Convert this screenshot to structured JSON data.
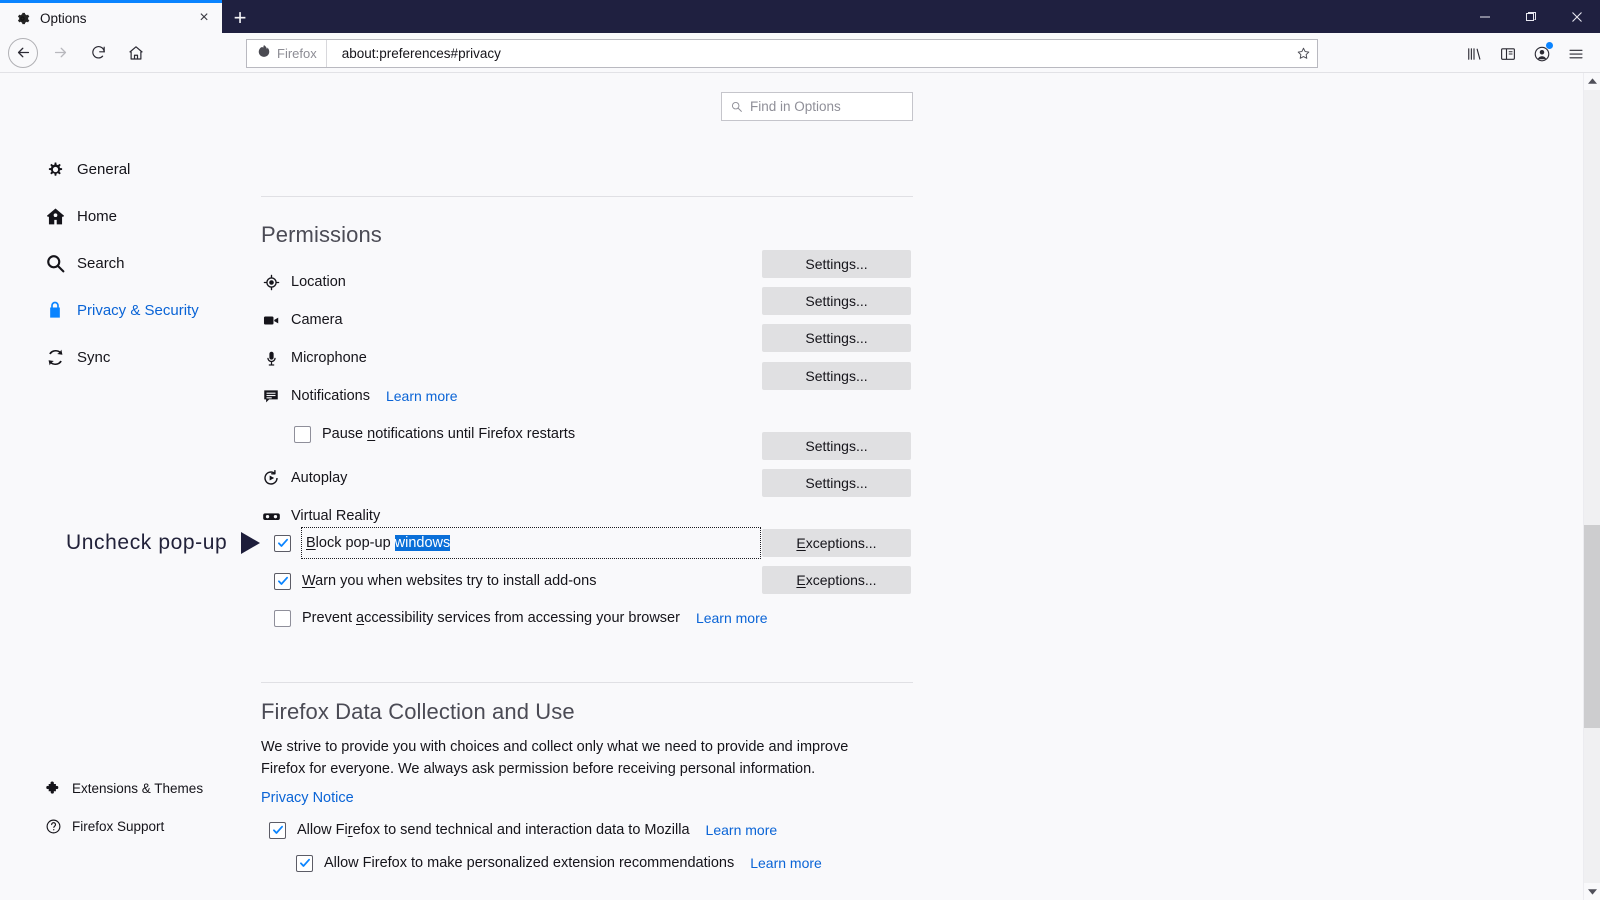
{
  "window": {
    "minimize_label": "—",
    "maximize_label": "❐",
    "close_label": "×"
  },
  "tab": {
    "title": "Options",
    "favicon": "gear-icon",
    "close_label": "×",
    "newtab_label": "+"
  },
  "toolbar": {
    "back_label": "←",
    "forward_label": "→",
    "reload_label": "↻",
    "home_label": "⌂",
    "url_chip_label": "Firefox",
    "url": "about:preferences#privacy",
    "star_label": "☆",
    "library_label": "library-icon",
    "sidebar_label": "sidebar-icon",
    "account_label": "account-icon",
    "menu_label": "≡"
  },
  "search": {
    "placeholder": "Find in Options",
    "value": ""
  },
  "sidebar": {
    "items": [
      {
        "label": "General",
        "icon": "gear-icon",
        "active": false
      },
      {
        "label": "Home",
        "icon": "home-icon",
        "active": false
      },
      {
        "label": "Search",
        "icon": "search-icon",
        "active": false
      },
      {
        "label": "Privacy & Security",
        "icon": "lock-icon",
        "active": true
      },
      {
        "label": "Sync",
        "icon": "sync-icon",
        "active": false
      }
    ],
    "bottom_items": [
      {
        "label": "Extensions & Themes",
        "icon": "puzzle-icon"
      },
      {
        "label": "Firefox Support",
        "icon": "question-circle-icon"
      }
    ]
  },
  "permissions": {
    "heading": "Permissions",
    "rows": [
      {
        "label": "Location",
        "icon": "location-icon",
        "button": "Settings...",
        "accel": "t"
      },
      {
        "label": "Camera",
        "icon": "camera-icon",
        "button": "Settings...",
        "accel": "t"
      },
      {
        "label": "Microphone",
        "icon": "microphone-icon",
        "button": "Settings...",
        "accel": "t"
      },
      {
        "label": "Notifications",
        "icon": "notification-icon",
        "button": "Settings...",
        "accel": "t",
        "learn_more": "Learn more"
      },
      {
        "label": "Autoplay",
        "icon": "autoplay-icon",
        "button": "Settings...",
        "accel": "t"
      },
      {
        "label": "Virtual Reality",
        "icon": "vr-icon",
        "button": "Settings...",
        "accel": "t"
      }
    ],
    "pause_notifications": {
      "pre": "Pause ",
      "accel": "n",
      "post": "otifications until Firefox restarts",
      "checked": false
    }
  },
  "popup_section": {
    "block_popups": {
      "pre": "",
      "accel": "B",
      "mid": "lock pop-up ",
      "selected": "windows",
      "checked": true,
      "button": "Exceptions...",
      "button_accel": "E",
      "focused": true
    },
    "warn_addons": {
      "accel": "W",
      "post": "arn you when websites try to install add-ons",
      "checked": true,
      "button": "Exceptions...",
      "button_accel": "E"
    },
    "prevent_accessibility": {
      "pre": "Prevent ",
      "accel": "a",
      "post": "ccessibility services from accessing your browser",
      "checked": false,
      "learn_more": "Learn more"
    }
  },
  "annotation": {
    "text": "Uncheck pop-up",
    "arrow": "triangle-right-icon"
  },
  "data_collection": {
    "heading": "Firefox Data Collection and Use",
    "paragraph_line1": "We strive to provide you with choices and collect only what we need to provide and improve",
    "paragraph_line2": "Firefox for everyone. We always ask permission before receiving personal information.",
    "privacy_notice": "Privacy Notice",
    "allow_technical": {
      "pre": "Allow Fi",
      "accel": "r",
      "post": "efox to send technical and interaction data to Mozilla",
      "checked": true,
      "learn_more": "Learn more"
    },
    "allow_recommendations": {
      "label": "Allow Firefox to make personalized extension recommendations",
      "checked": true,
      "learn_more": "Learn more"
    }
  },
  "colors": {
    "titlebar": "#1f2040",
    "accent_blue": "#0a84ff",
    "link_blue": "#0a64d6",
    "selection_blue": "#0a6fd8",
    "page_bg": "#f9f9fb",
    "button_bg": "#e0e0e2"
  }
}
